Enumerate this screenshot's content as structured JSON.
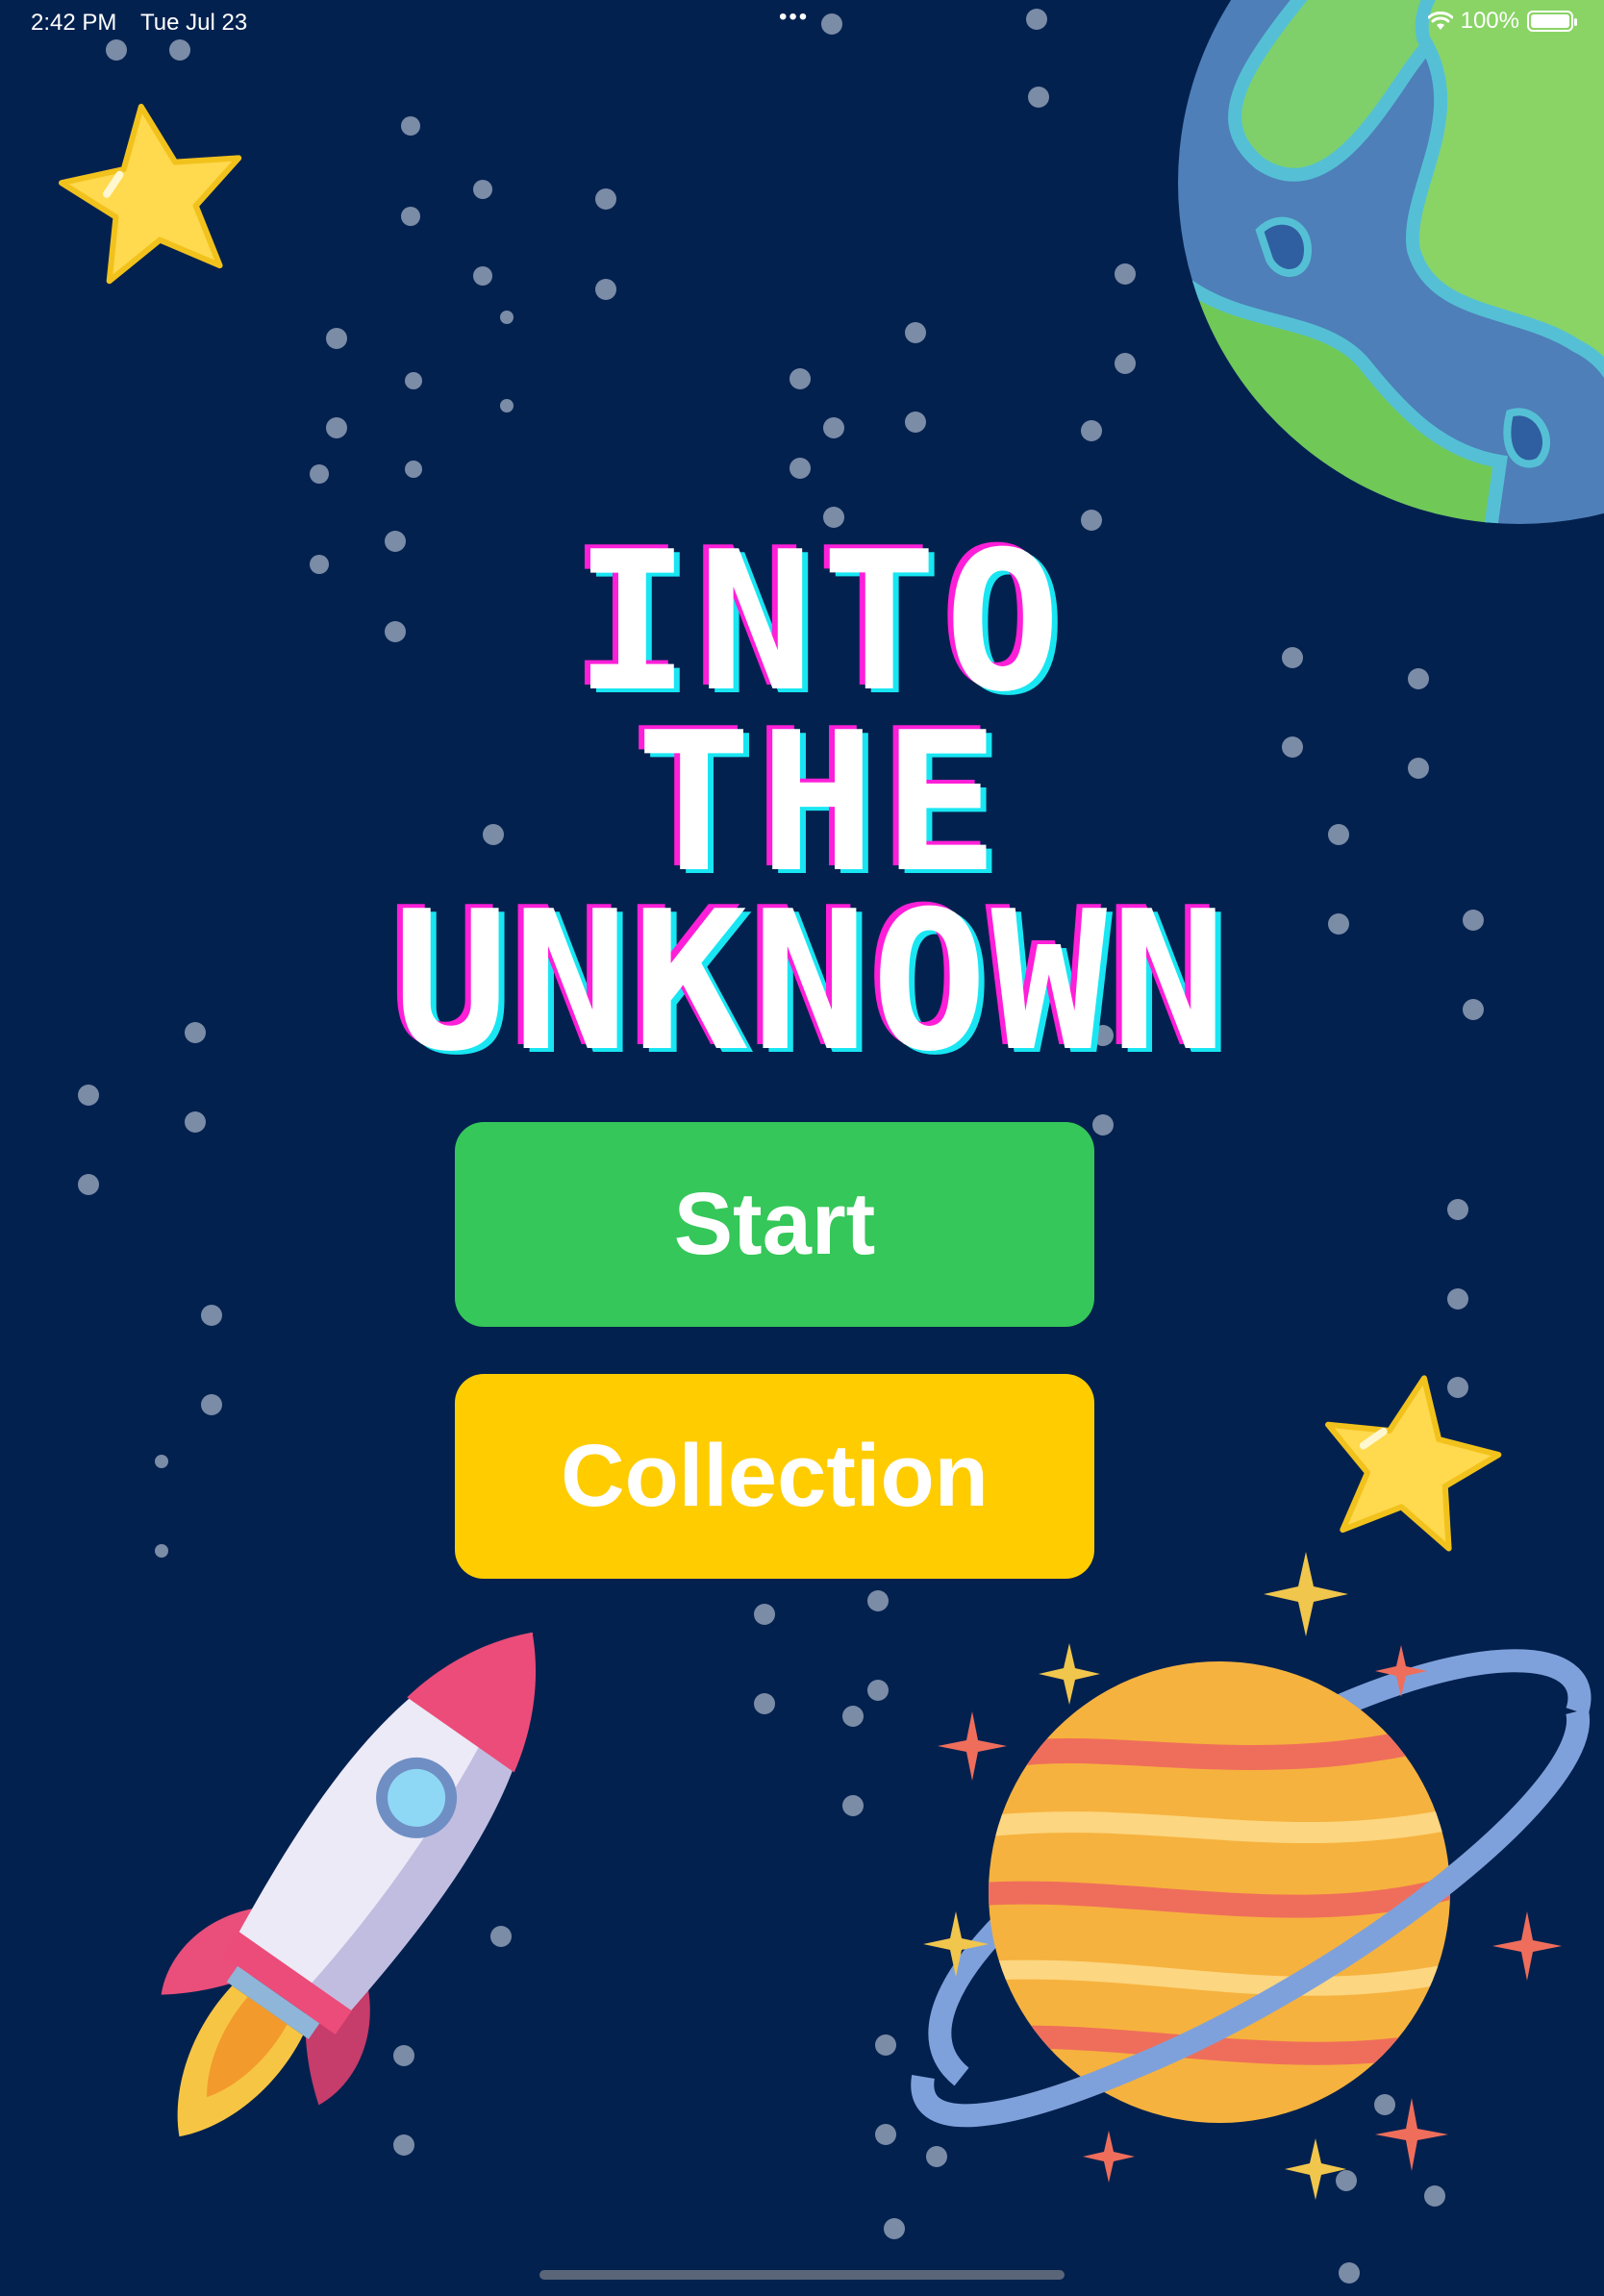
{
  "status_bar": {
    "time": "2:42 PM",
    "date": "Tue Jul 23",
    "battery": "100%",
    "dots": "•••"
  },
  "title": {
    "line1": "INTO",
    "line2": "THE",
    "line3": "UNKNOWN"
  },
  "buttons": {
    "start_label": "Start",
    "collection_label": "Collection"
  },
  "colors": {
    "background": "#03214f",
    "start": "#35c759",
    "collection": "#ffcc00",
    "title_magenta": "#ff1fd8",
    "title_cyan": "#18e6f2"
  },
  "icons": [
    "wifi-icon",
    "battery-icon",
    "star-icon",
    "earth-icon",
    "rocket-icon",
    "saturn-icon",
    "sparkle-icon"
  ]
}
